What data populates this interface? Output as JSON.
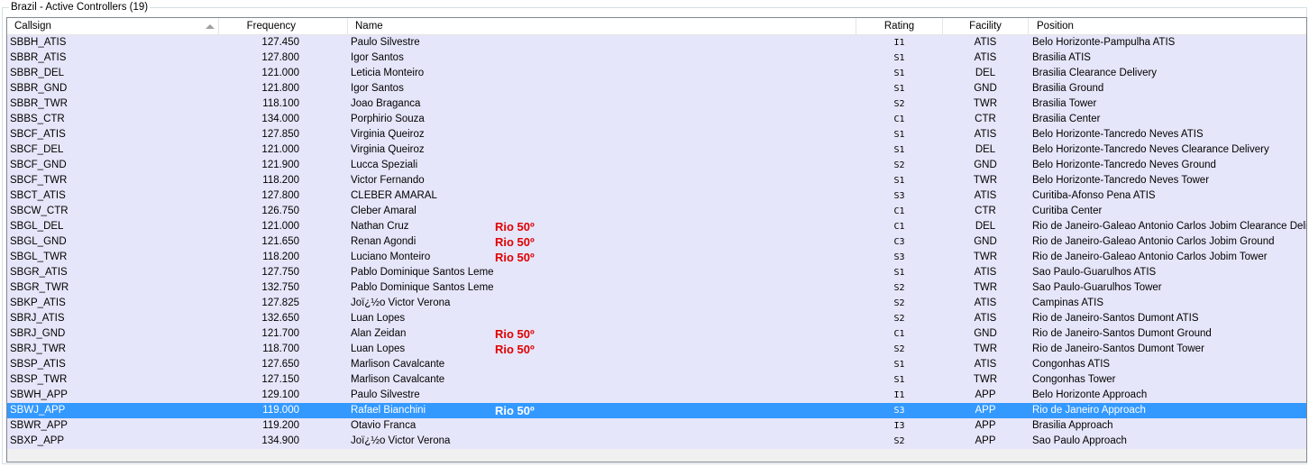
{
  "window": {
    "group_title": "Brazil - Active Controllers (19)"
  },
  "columns": [
    "Callsign",
    "Frequency",
    "Name",
    "Rating",
    "Facility",
    "Position"
  ],
  "rows": [
    {
      "callsign": "SBBH_ATIS",
      "frequency": "127.450",
      "name": "Paulo Silvestre",
      "note": "",
      "rating": "I1",
      "facility": "ATIS",
      "position": "Belo Horizonte-Pampulha ATIS"
    },
    {
      "callsign": "SBBR_ATIS",
      "frequency": "127.800",
      "name": "Igor Santos",
      "note": "",
      "rating": "S1",
      "facility": "ATIS",
      "position": "Brasilia ATIS"
    },
    {
      "callsign": "SBBR_DEL",
      "frequency": "121.000",
      "name": "Leticia Monteiro",
      "note": "",
      "rating": "S1",
      "facility": "DEL",
      "position": "Brasilia Clearance Delivery"
    },
    {
      "callsign": "SBBR_GND",
      "frequency": "121.800",
      "name": "Igor Santos",
      "note": "",
      "rating": "S1",
      "facility": "GND",
      "position": "Brasilia Ground"
    },
    {
      "callsign": "SBBR_TWR",
      "frequency": "118.100",
      "name": "Joao Braganca",
      "note": "",
      "rating": "S2",
      "facility": "TWR",
      "position": "Brasilia Tower"
    },
    {
      "callsign": "SBBS_CTR",
      "frequency": "134.000",
      "name": "Porphirio Souza",
      "note": "",
      "rating": "C1",
      "facility": "CTR",
      "position": "Brasilia Center"
    },
    {
      "callsign": "SBCF_ATIS",
      "frequency": "127.850",
      "name": "Virginia Queiroz",
      "note": "",
      "rating": "S1",
      "facility": "ATIS",
      "position": "Belo Horizonte-Tancredo Neves ATIS"
    },
    {
      "callsign": "SBCF_DEL",
      "frequency": "121.000",
      "name": "Virginia Queiroz",
      "note": "",
      "rating": "S1",
      "facility": "DEL",
      "position": "Belo Horizonte-Tancredo Neves Clearance Delivery"
    },
    {
      "callsign": "SBCF_GND",
      "frequency": "121.900",
      "name": "Lucca Speziali",
      "note": "",
      "rating": "S2",
      "facility": "GND",
      "position": "Belo Horizonte-Tancredo Neves Ground"
    },
    {
      "callsign": "SBCF_TWR",
      "frequency": "118.200",
      "name": "Victor Fernando",
      "note": "",
      "rating": "S1",
      "facility": "TWR",
      "position": "Belo Horizonte-Tancredo Neves Tower"
    },
    {
      "callsign": "SBCT_ATIS",
      "frequency": "127.800",
      "name": "CLEBER AMARAL",
      "note": "",
      "rating": "S3",
      "facility": "ATIS",
      "position": "Curitiba-Afonso Pena ATIS"
    },
    {
      "callsign": "SBCW_CTR",
      "frequency": "126.750",
      "name": "Cleber Amaral",
      "note": "",
      "rating": "C1",
      "facility": "CTR",
      "position": "Curitiba Center"
    },
    {
      "callsign": "SBGL_DEL",
      "frequency": "121.000",
      "name": "Nathan Cruz",
      "note": "Rio 50º",
      "rating": "C1",
      "facility": "DEL",
      "position": "Rio de Janeiro-Galeao Antonio Carlos Jobim Clearance Delivery"
    },
    {
      "callsign": "SBGL_GND",
      "frequency": "121.650",
      "name": "Renan Agondi",
      "note": "Rio 50º",
      "rating": "C3",
      "facility": "GND",
      "position": "Rio de Janeiro-Galeao Antonio Carlos Jobim Ground"
    },
    {
      "callsign": "SBGL_TWR",
      "frequency": "118.200",
      "name": "Luciano Monteiro",
      "note": "Rio 50º",
      "rating": "S3",
      "facility": "TWR",
      "position": "Rio de Janeiro-Galeao Antonio Carlos Jobim Tower"
    },
    {
      "callsign": "SBGR_ATIS",
      "frequency": "127.750",
      "name": "Pablo Dominique Santos Leme",
      "note": "",
      "rating": "S1",
      "facility": "ATIS",
      "position": "Sao Paulo-Guarulhos ATIS"
    },
    {
      "callsign": "SBGR_TWR",
      "frequency": "132.750",
      "name": "Pablo Dominique Santos Leme",
      "note": "",
      "rating": "S2",
      "facility": "TWR",
      "position": "Sao Paulo-Guarulhos Tower"
    },
    {
      "callsign": "SBKP_ATIS",
      "frequency": "127.825",
      "name": "Joï¿½o Victor Verona",
      "note": "",
      "rating": "S2",
      "facility": "ATIS",
      "position": "Campinas ATIS"
    },
    {
      "callsign": "SBRJ_ATIS",
      "frequency": "132.650",
      "name": "Luan Lopes",
      "note": "",
      "rating": "S2",
      "facility": "ATIS",
      "position": "Rio de Janeiro-Santos Dumont ATIS"
    },
    {
      "callsign": "SBRJ_GND",
      "frequency": "121.700",
      "name": "Alan Zeidan",
      "note": "Rio 50º",
      "rating": "C1",
      "facility": "GND",
      "position": "Rio de Janeiro-Santos Dumont Ground"
    },
    {
      "callsign": "SBRJ_TWR",
      "frequency": "118.700",
      "name": "Luan Lopes",
      "note": "Rio 50º",
      "rating": "S2",
      "facility": "TWR",
      "position": "Rio de Janeiro-Santos Dumont Tower"
    },
    {
      "callsign": "SBSP_ATIS",
      "frequency": "127.650",
      "name": "Marlison Cavalcante",
      "note": "",
      "rating": "S1",
      "facility": "ATIS",
      "position": "Congonhas ATIS"
    },
    {
      "callsign": "SBSP_TWR",
      "frequency": "127.150",
      "name": "Marlison Cavalcante",
      "note": "",
      "rating": "S1",
      "facility": "TWR",
      "position": "Congonhas Tower"
    },
    {
      "callsign": "SBWH_APP",
      "frequency": "129.100",
      "name": "Paulo Silvestre",
      "note": "",
      "rating": "I1",
      "facility": "APP",
      "position": "Belo Horizonte Approach"
    },
    {
      "callsign": "SBWJ_APP",
      "frequency": "119.000",
      "name": "Rafael Bianchini",
      "note": "Rio 50º",
      "rating": "S3",
      "facility": "APP",
      "position": "Rio de Janeiro Approach",
      "selected": true
    },
    {
      "callsign": "SBWR_APP",
      "frequency": "119.200",
      "name": "Otavio Franca",
      "note": "",
      "rating": "I3",
      "facility": "APP",
      "position": "Brasilia Approach"
    },
    {
      "callsign": "SBXP_APP",
      "frequency": "134.900",
      "name": "Joï¿½o Victor Verona",
      "note": "",
      "rating": "S2",
      "facility": "APP",
      "position": "Sao Paulo Approach"
    }
  ],
  "colors": {
    "row_bg": "#e6e6fa",
    "selected_bg": "#3399ff",
    "note_red": "#e00000"
  }
}
